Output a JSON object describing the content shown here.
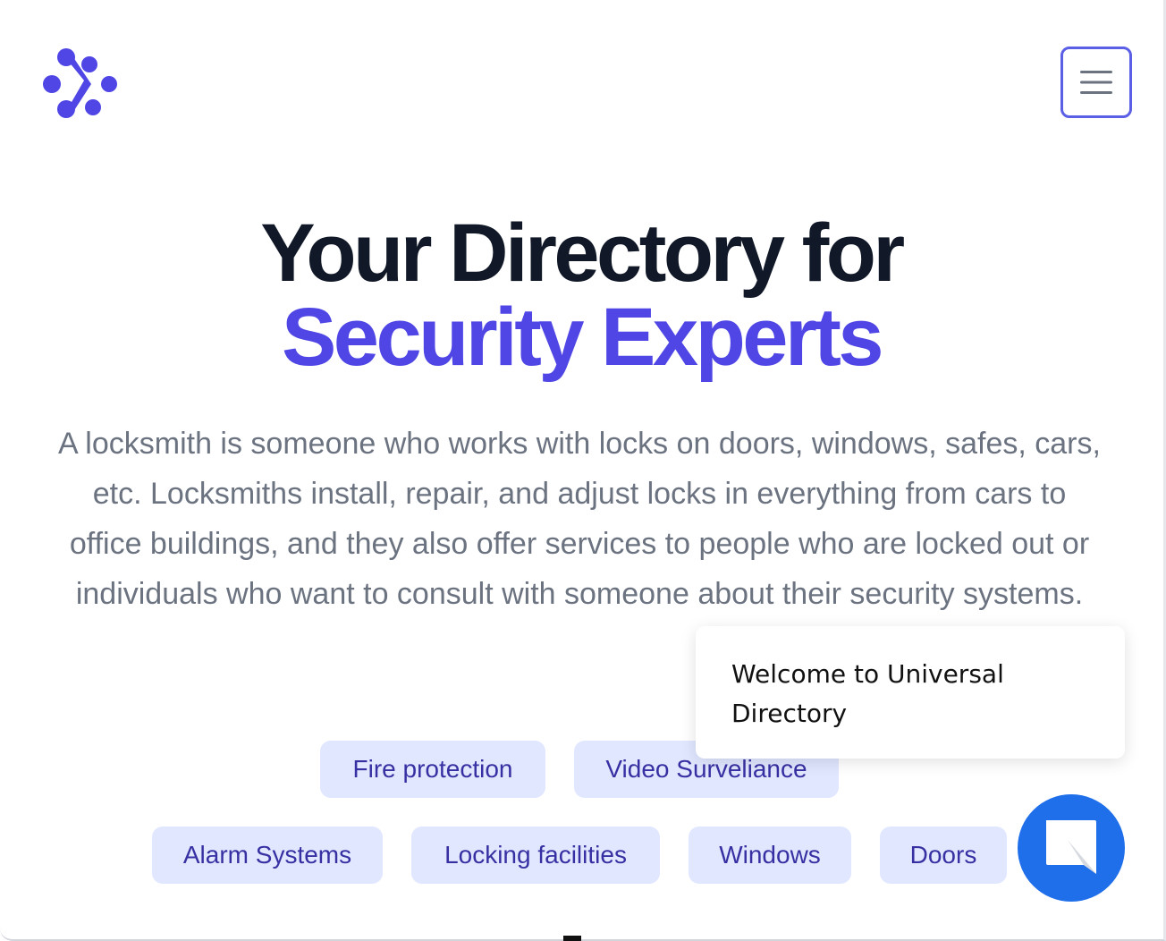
{
  "header": {
    "logo_icon": "directory-logo-icon",
    "menu_icon": "hamburger-menu-icon",
    "accent_color": "#4f46e5"
  },
  "hero": {
    "title_line1": "Your Directory for",
    "title_line2": "Security Experts",
    "description": "A locksmith is someone who works with locks on doors, windows, safes, cars, etc. Locksmiths install, repair, and adjust locks in everything from cars to office buildings, and they also offer services to people who are locked out or individuals who want to consult with someone about their security systems."
  },
  "tags": [
    {
      "label": "Fire protection"
    },
    {
      "label": "Video Surveliance"
    },
    {
      "label": "Alarm Systems"
    },
    {
      "label": "Locking facilities"
    },
    {
      "label": "Windows"
    },
    {
      "label": "Doors"
    }
  ],
  "chat": {
    "welcome_message": "Welcome to Universal Directory",
    "button_icon": "chat-bubble-icon",
    "button_color": "#1f6feb"
  }
}
